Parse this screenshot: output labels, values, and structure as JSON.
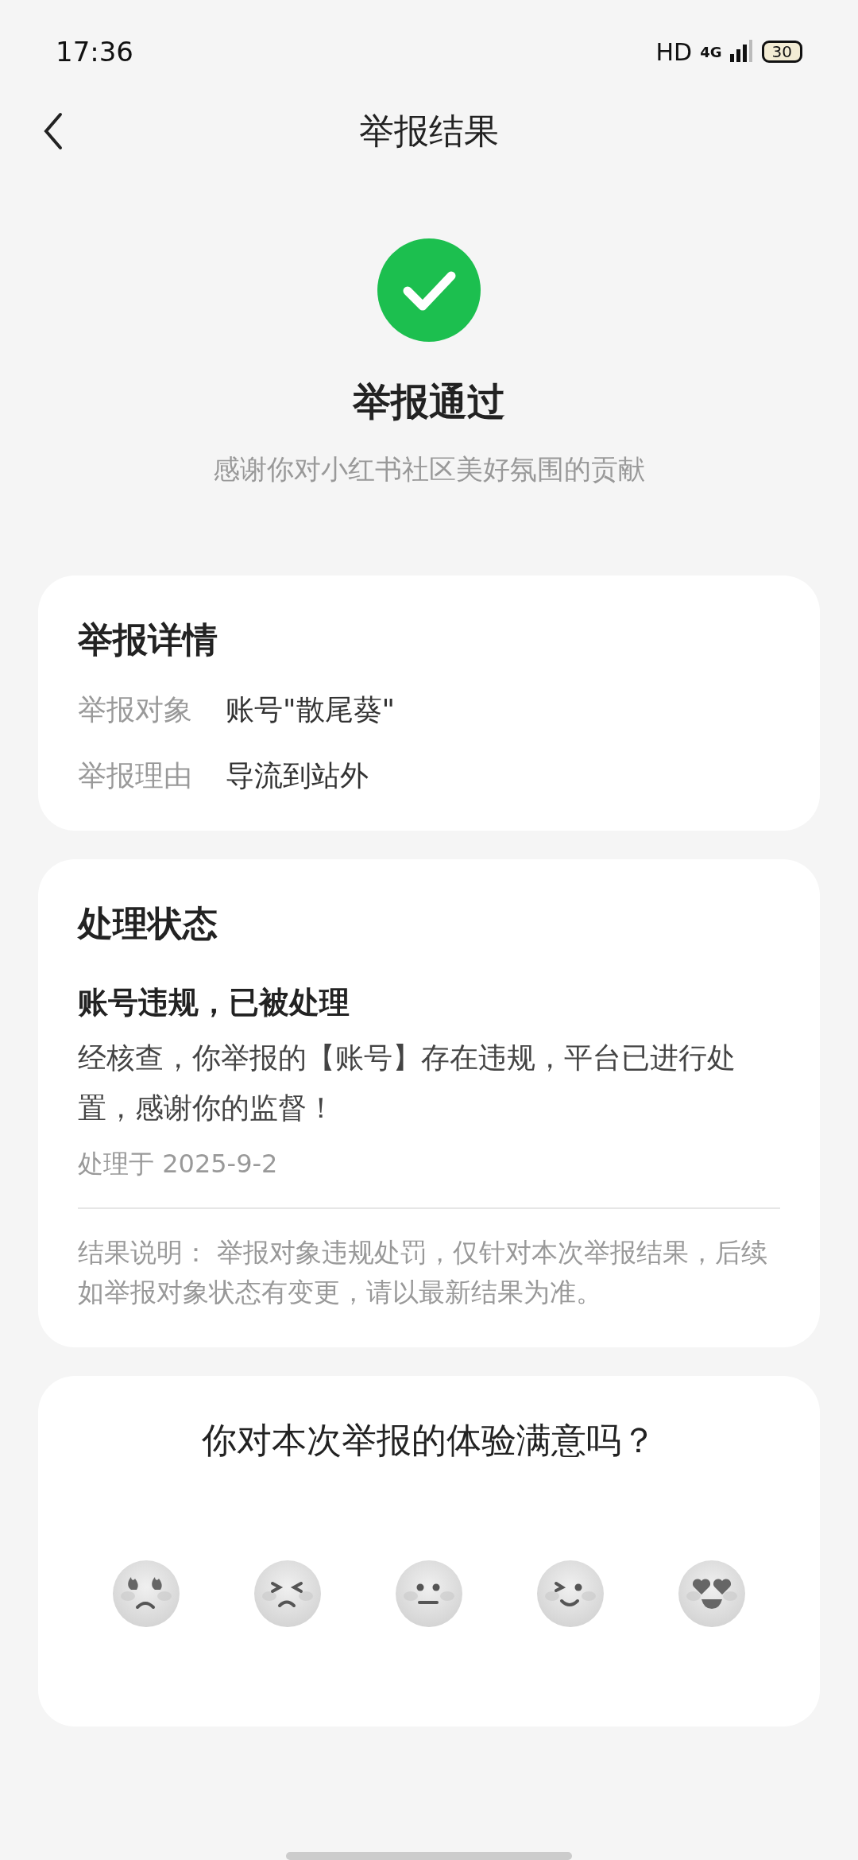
{
  "status_bar": {
    "time": "17:36",
    "hd": "HD",
    "network": "4G",
    "battery": "30"
  },
  "header": {
    "title": "举报结果"
  },
  "result": {
    "title": "举报通过",
    "subtitle": "感谢你对小红书社区美好氛围的贡献"
  },
  "details": {
    "title": "举报详情",
    "rows": [
      {
        "label": "举报对象",
        "value": "账号\"散尾葵\""
      },
      {
        "label": "举报理由",
        "value": "导流到站外"
      }
    ]
  },
  "status": {
    "title": "处理状态",
    "headline": "账号违规，已被处理",
    "message": "经核查，你举报的【账号】存在违规，平台已进行处置，感谢你的监督！",
    "date": "处理于 2025-9-2",
    "note": "结果说明： 举报对象违规处罚，仅针对本次举报结果，后续如举报对象状态有变更，请以最新结果为准。"
  },
  "survey": {
    "question": "你对本次举报的体验满意吗？",
    "faces": [
      {
        "kind": "angry"
      },
      {
        "kind": "wince"
      },
      {
        "kind": "neutral"
      },
      {
        "kind": "wink"
      },
      {
        "kind": "love"
      }
    ]
  }
}
